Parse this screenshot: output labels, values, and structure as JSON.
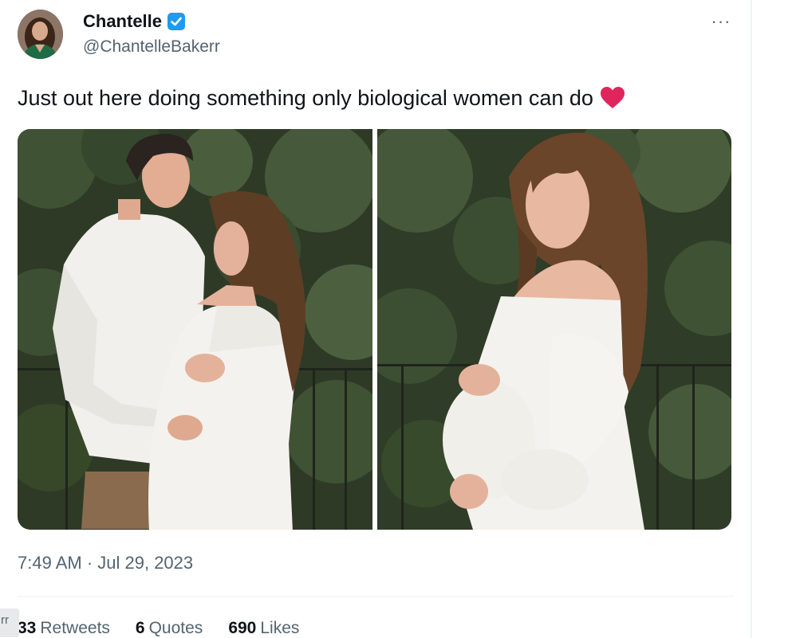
{
  "author": {
    "display_name": "Chantelle",
    "handle": "@ChantelleBakerr",
    "verified": true,
    "avatar_icon": "avatar-photo"
  },
  "more_menu": {
    "label": "···"
  },
  "tweet": {
    "text": "Just out here doing something only biological women can do",
    "emoji_icon": "red-heart-emoji"
  },
  "media": [
    {
      "icon": "photo-couple-maternity"
    },
    {
      "icon": "photo-woman-maternity"
    }
  ],
  "timestamp": "7:49 AM · Jul 29, 2023",
  "stats": {
    "retweets_count": "33",
    "retweets_label": "Retweets",
    "quotes_count": "6",
    "quotes_label": "Quotes",
    "likes_count": "690",
    "likes_label": "Likes"
  },
  "corner_tab": {
    "label": "rr"
  },
  "colors": {
    "text_primary": "#0f1419",
    "text_secondary": "#536471",
    "verified_blue": "#1d9bf0",
    "heart_red": "#e0245e",
    "divider": "#eff3f4"
  }
}
